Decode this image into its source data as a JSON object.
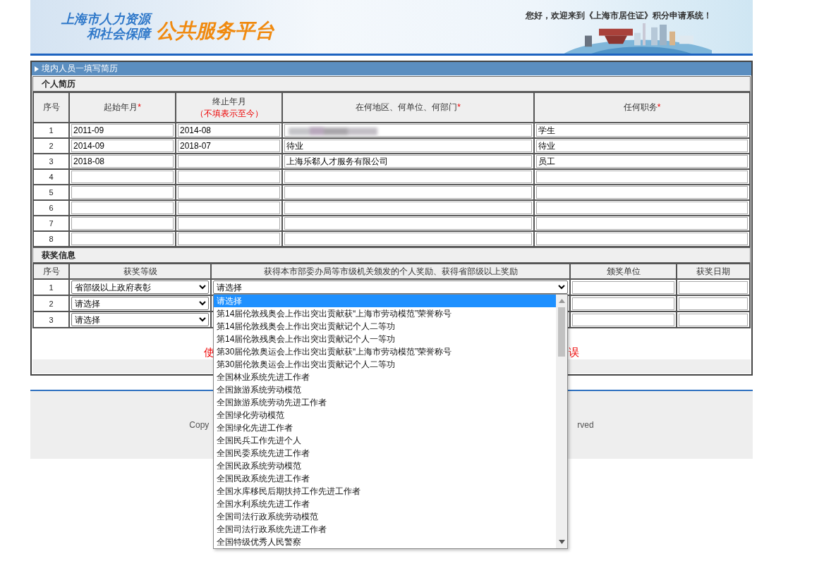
{
  "header": {
    "logo_line_1": "上海市人力资源",
    "logo_line_2": "和社会保障",
    "logo_title": "公共服务平台",
    "welcome": "您好，欢迎来到《上海市居住证》积分申请系统！"
  },
  "panel": {
    "title": "境内人员一填写简历"
  },
  "resume": {
    "section_title": "个人简历",
    "columns": [
      {
        "label": "序号"
      },
      {
        "label": "起始年月",
        "required_mark": "*"
      },
      {
        "label": "终止年月",
        "note": "（不填表示至今）"
      },
      {
        "label": "在何地区、何单位、何部门",
        "required_mark": "*"
      },
      {
        "label": "任何职务",
        "required_mark": "*"
      }
    ],
    "rows": [
      {
        "index": "1",
        "start": "2011-09",
        "end": "2014-08",
        "place": "",
        "place_blurred": true,
        "position": "学生"
      },
      {
        "index": "2",
        "start": "2014-09",
        "end": "2018-07",
        "place": "待业",
        "place_blurred": false,
        "position": "待业"
      },
      {
        "index": "3",
        "start": "2018-08",
        "end": "",
        "place": "上海乐郗人才服务有限公司",
        "place_blurred": false,
        "position": "员工"
      },
      {
        "index": "4",
        "start": "",
        "end": "",
        "place": "",
        "place_blurred": false,
        "position": ""
      },
      {
        "index": "5",
        "start": "",
        "end": "",
        "place": "",
        "place_blurred": false,
        "position": ""
      },
      {
        "index": "6",
        "start": "",
        "end": "",
        "place": "",
        "place_blurred": false,
        "position": ""
      },
      {
        "index": "7",
        "start": "",
        "end": "",
        "place": "",
        "place_blurred": false,
        "position": ""
      },
      {
        "index": "8",
        "start": "",
        "end": "",
        "place": "",
        "place_blurred": false,
        "position": ""
      }
    ]
  },
  "awards": {
    "section_title": "获奖信息",
    "columns": [
      {
        "label": "序号"
      },
      {
        "label": "获奖等级"
      },
      {
        "label": "获得本市部委办局等市级机关颁发的个人奖励、获得省部级以上奖励"
      },
      {
        "label": "颁奖单位"
      },
      {
        "label": "获奖日期"
      }
    ],
    "rows": [
      {
        "index": "1",
        "level": "省部级以上政府表彰",
        "award": "请选择"
      },
      {
        "index": "2",
        "level": "请选择",
        "award": ""
      },
      {
        "index": "3",
        "level": "请选择",
        "award": ""
      }
    ]
  },
  "dropdown": {
    "expanded": true,
    "options": [
      {
        "label": "请选择",
        "selected": true
      },
      {
        "label": "第14届伦敦残奥会上作出突出贡献获“上海市劳动模范”荣誉称号",
        "selected": false
      },
      {
        "label": "第14届伦敦残奥会上作出突出贡献记个人二等功",
        "selected": false
      },
      {
        "label": "第14届伦敦残奥会上作出突出贡献记个人一等功",
        "selected": false
      },
      {
        "label": "第30届伦敦奥运会上作出突出贡献获“上海市劳动模范”荣誉称号",
        "selected": false
      },
      {
        "label": "第30届伦敦奥运会上作出突出贡献记个人二等功",
        "selected": false
      },
      {
        "label": "全国林业系统先进工作者",
        "selected": false
      },
      {
        "label": "全国旅游系统劳动模范",
        "selected": false
      },
      {
        "label": "全国旅游系统劳动先进工作者",
        "selected": false
      },
      {
        "label": "全国绿化劳动模范",
        "selected": false
      },
      {
        "label": "全国绿化先进工作者",
        "selected": false
      },
      {
        "label": "全国民兵工作先进个人",
        "selected": false
      },
      {
        "label": "全国民委系统先进工作者",
        "selected": false
      },
      {
        "label": "全国民政系统劳动模范",
        "selected": false
      },
      {
        "label": "全国民政系统先进工作者",
        "selected": false
      },
      {
        "label": "全国水库移民后期扶持工作先进工作者",
        "selected": false
      },
      {
        "label": "全国水利系统先进工作者",
        "selected": false
      },
      {
        "label": "全国司法行政系统劳动模范",
        "selected": false
      },
      {
        "label": "全国司法行政系统先进工作者",
        "selected": false
      },
      {
        "label": "全国特级优秀人民警察",
        "selected": false
      }
    ]
  },
  "notice": {
    "left_fragment": "使",
    "right_fragment": "误"
  },
  "footer": {
    "left_fragment": "Copy",
    "right_fragment": "rved"
  }
}
